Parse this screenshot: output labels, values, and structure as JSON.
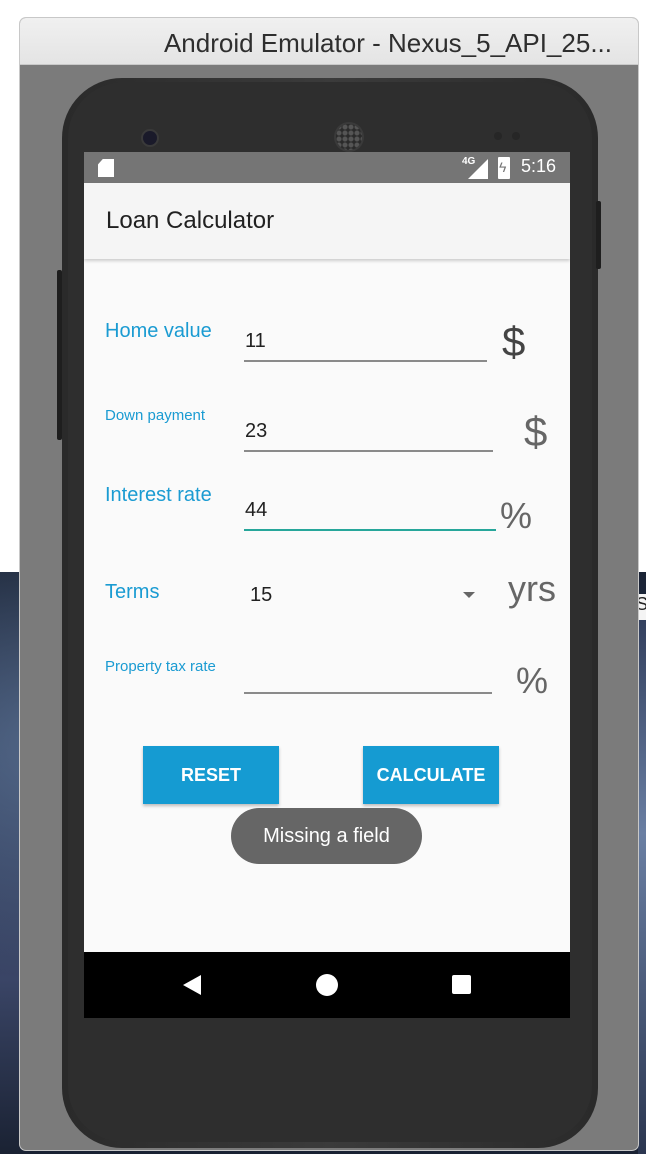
{
  "window": {
    "title": "Android Emulator - Nexus_5_API_25..."
  },
  "statusbar": {
    "network": "4G",
    "time": "5:16",
    "icons": [
      "sd-card-icon",
      "signal-icon",
      "battery-charging-icon"
    ]
  },
  "app": {
    "title": "Loan Calculator"
  },
  "form": {
    "home_value": {
      "label": "Home value",
      "value": "11",
      "unit": "$"
    },
    "down_payment": {
      "label": "Down payment",
      "value": "23",
      "unit": "$"
    },
    "interest_rate": {
      "label": "Interest rate",
      "value": "44",
      "unit": "%"
    },
    "terms": {
      "label": "Terms",
      "selected": "15",
      "unit": "yrs"
    },
    "property_tax_rate": {
      "label": "Property tax rate",
      "value": "",
      "unit": "%"
    }
  },
  "buttons": {
    "reset": "RESET",
    "calculate": "CALCULATE"
  },
  "toast": {
    "message": "Missing a field"
  },
  "navbar": {
    "icons": [
      "back-icon",
      "home-icon",
      "recents-icon"
    ]
  },
  "colors": {
    "accent": "#1a9bd2",
    "button": "#159bd2",
    "focus_underline": "#26a69a",
    "statusbar": "#757575"
  }
}
